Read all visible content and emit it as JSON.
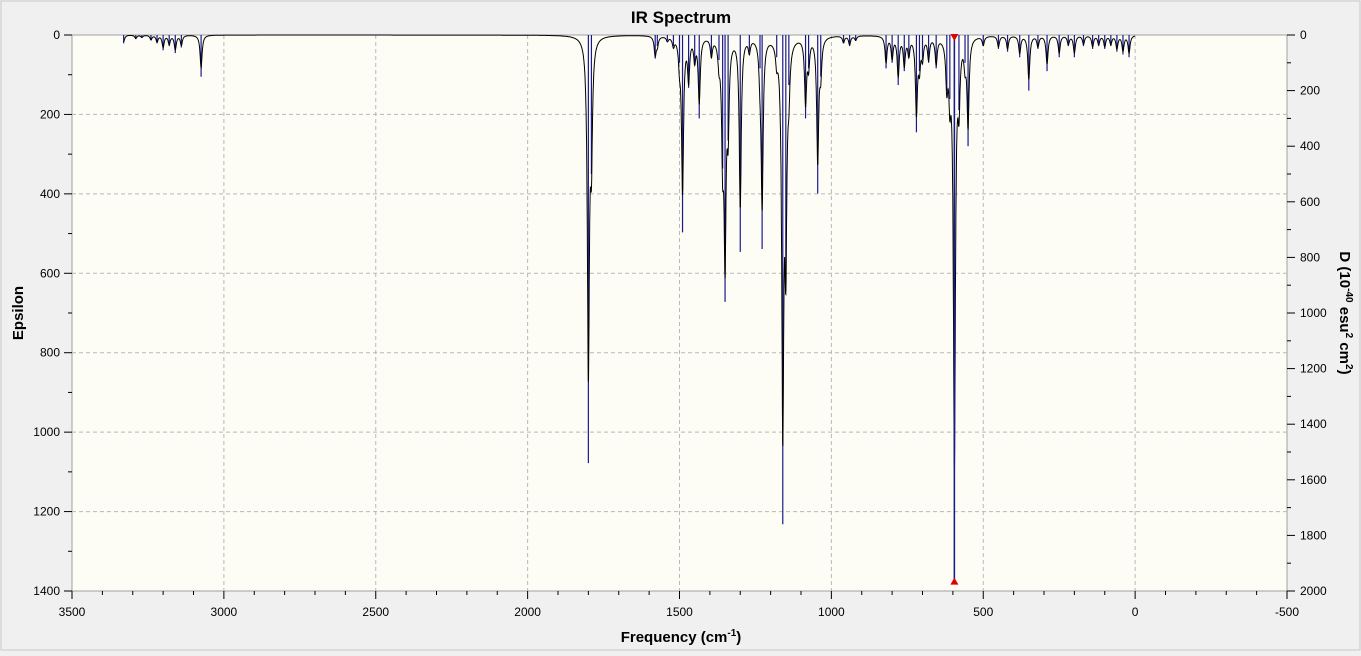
{
  "chart_data": {
    "type": "line",
    "title": "IR Spectrum",
    "xlabel": {
      "base": "Frequency (cm",
      "sup": "-1",
      "tail": ")"
    },
    "ylabel_left": "Epsilon",
    "ylabel_right": {
      "p1": "D (10",
      "sup1": "-40",
      "p2": " esu",
      "sup2": "2",
      "p3": " cm",
      "sup3": "2",
      "p4": ")"
    },
    "x_axis": {
      "min": -500,
      "max": 3500,
      "reversed": true,
      "ticks": [
        3500,
        3000,
        2500,
        2000,
        1500,
        1000,
        500,
        0,
        -500
      ]
    },
    "y_left_axis": {
      "min": 0,
      "max": 1400,
      "inverted": true,
      "ticks": [
        0,
        200,
        400,
        600,
        800,
        1000,
        1200,
        1400
      ]
    },
    "y_right_axis": {
      "min": 0,
      "max": 2000,
      "inverted": true,
      "ticks": [
        0,
        200,
        400,
        600,
        800,
        1000,
        1200,
        1400,
        1600,
        1800,
        2000
      ]
    },
    "grid": true,
    "colors": {
      "spectrum": "#000000",
      "sticks": "#1a1a8c",
      "marker": "#e00000",
      "plot_bg": "#fdfdf5",
      "grid": "#b8b8b8"
    },
    "selected_peak_frequency": 595,
    "sticks": [
      [
        3330,
        30
      ],
      [
        3290,
        15
      ],
      [
        3270,
        10
      ],
      [
        3240,
        20
      ],
      [
        3220,
        30
      ],
      [
        3200,
        55
      ],
      [
        3180,
        40
      ],
      [
        3160,
        65
      ],
      [
        3140,
        45
      ],
      [
        3075,
        150
      ],
      [
        1800,
        1540
      ],
      [
        1790,
        500
      ],
      [
        1580,
        85
      ],
      [
        1573,
        40
      ],
      [
        1540,
        20
      ],
      [
        1520,
        40
      ],
      [
        1500,
        100
      ],
      [
        1490,
        710
      ],
      [
        1470,
        190
      ],
      [
        1450,
        100
      ],
      [
        1435,
        300
      ],
      [
        1395,
        80
      ],
      [
        1370,
        90
      ],
      [
        1358,
        480
      ],
      [
        1350,
        960
      ],
      [
        1340,
        380
      ],
      [
        1300,
        780
      ],
      [
        1270,
        60
      ],
      [
        1235,
        120
      ],
      [
        1228,
        770
      ],
      [
        1180,
        80
      ],
      [
        1160,
        1760
      ],
      [
        1150,
        920
      ],
      [
        1140,
        180
      ],
      [
        1085,
        300
      ],
      [
        1075,
        120
      ],
      [
        1045,
        570
      ],
      [
        1035,
        150
      ],
      [
        960,
        30
      ],
      [
        940,
        40
      ],
      [
        920,
        20
      ],
      [
        820,
        120
      ],
      [
        800,
        100
      ],
      [
        780,
        180
      ],
      [
        760,
        130
      ],
      [
        745,
        80
      ],
      [
        720,
        350
      ],
      [
        710,
        130
      ],
      [
        700,
        90
      ],
      [
        680,
        100
      ],
      [
        655,
        120
      ],
      [
        620,
        200
      ],
      [
        610,
        230
      ],
      [
        595,
        1970
      ],
      [
        580,
        270
      ],
      [
        560,
        100
      ],
      [
        550,
        400
      ],
      [
        500,
        40
      ],
      [
        450,
        50
      ],
      [
        420,
        60
      ],
      [
        380,
        80
      ],
      [
        350,
        200
      ],
      [
        320,
        50
      ],
      [
        290,
        130
      ],
      [
        250,
        80
      ],
      [
        220,
        40
      ],
      [
        200,
        80
      ],
      [
        170,
        40
      ],
      [
        140,
        50
      ],
      [
        120,
        40
      ],
      [
        100,
        50
      ],
      [
        80,
        40
      ],
      [
        60,
        60
      ],
      [
        40,
        70
      ],
      [
        20,
        80
      ]
    ]
  }
}
